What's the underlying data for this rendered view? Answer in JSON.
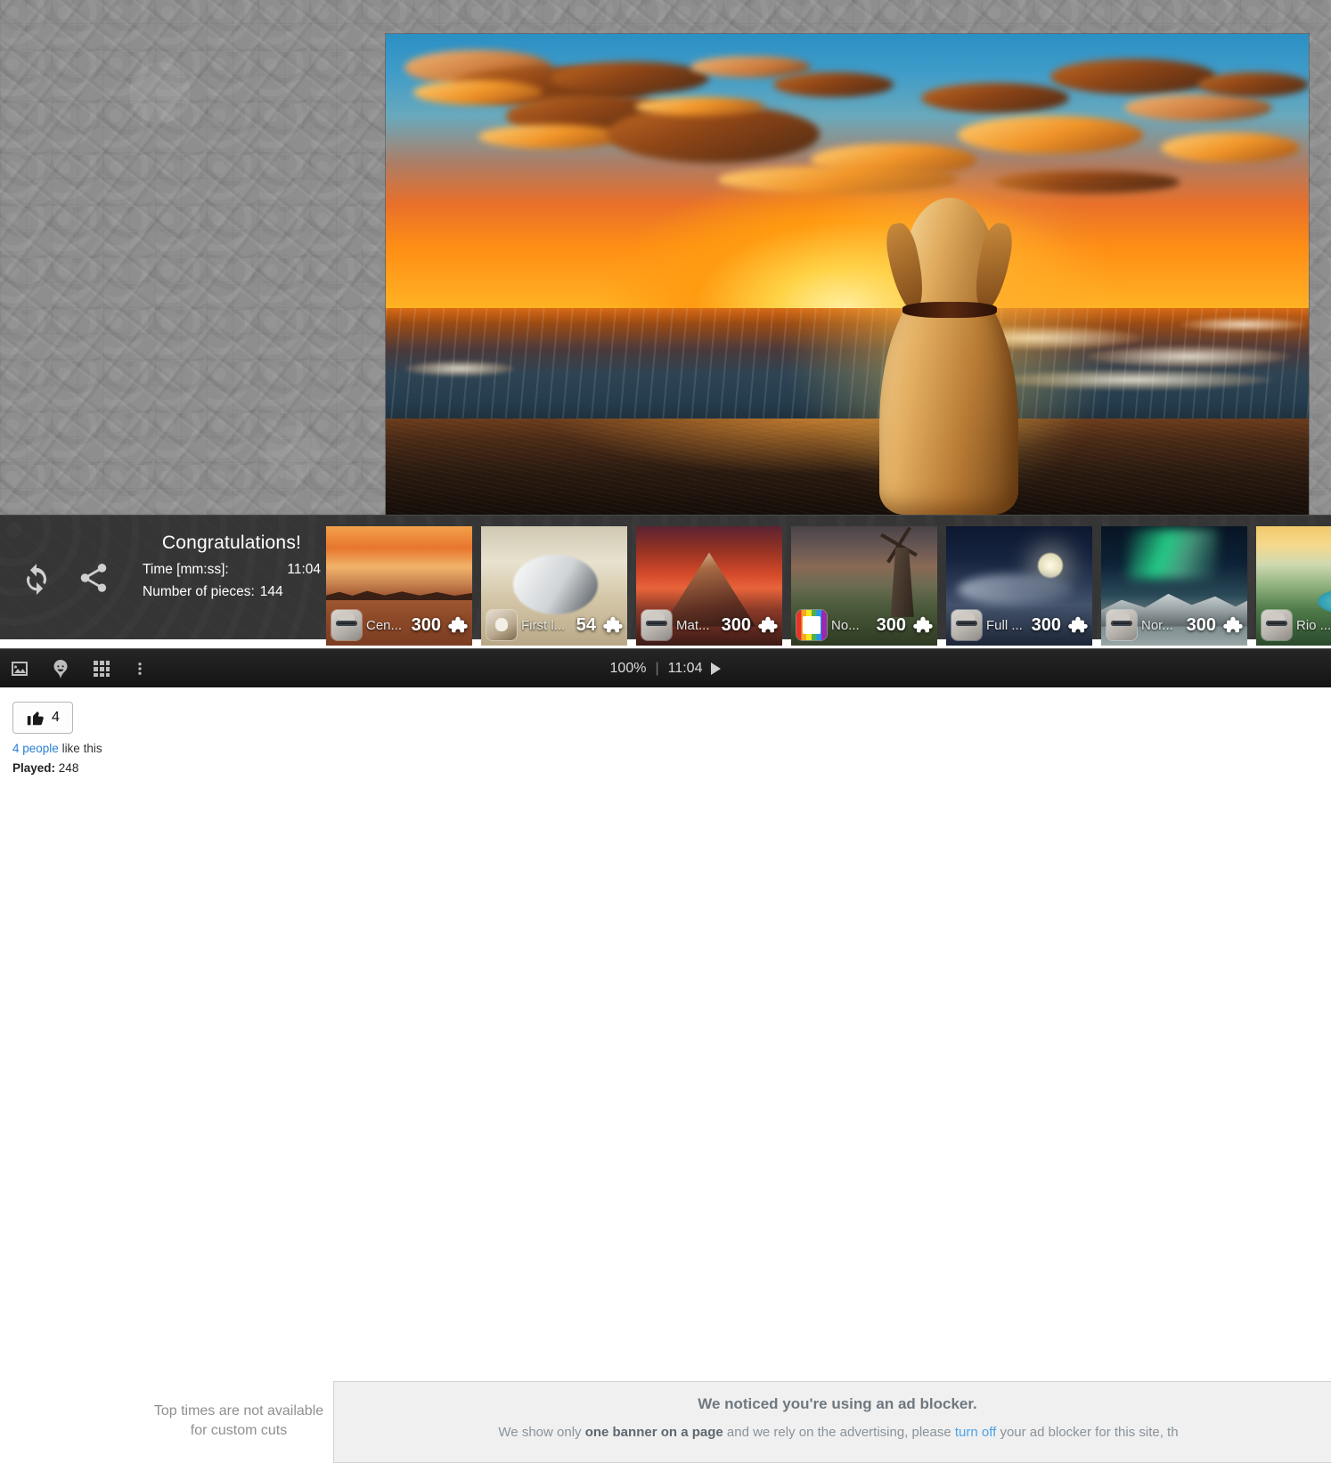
{
  "board": {
    "background_color": "#8e8e8e"
  },
  "puzzle_image": {
    "alt": "golden retriever dog sitting on beach watching ocean sunset"
  },
  "congrats": {
    "title": "Congratulations!",
    "time_label": "Time [mm:ss]:",
    "time_value": "11:04",
    "pieces_label": "Number of pieces:",
    "pieces_value": "144",
    "restart_icon": "refresh-icon",
    "share_icon": "share-icon"
  },
  "thumbnails": [
    {
      "name": "Cen...",
      "pieces": "300",
      "avatar": "face-glasses-avatar",
      "scene": "desert"
    },
    {
      "name": "First l...",
      "pieces": "54",
      "avatar": "goat-avatar",
      "scene": "dog"
    },
    {
      "name": "Mat...",
      "pieces": "300",
      "avatar": "face-glasses-avatar",
      "scene": "volcano"
    },
    {
      "name": "No...",
      "pieces": "300",
      "avatar": "rainbow-avatar",
      "scene": "mill"
    },
    {
      "name": "Full ...",
      "pieces": "300",
      "avatar": "face-glasses-avatar",
      "scene": "night"
    },
    {
      "name": "Nor...",
      "pieces": "300",
      "avatar": "face-glasses-avatar",
      "scene": "aurora"
    },
    {
      "name": "Rio ...",
      "pieces": "",
      "avatar": "face-glasses-avatar",
      "scene": "rio"
    }
  ],
  "toolbar": {
    "image_icon": "image-icon",
    "piece_icon": "puzzle-shape-icon",
    "grid_icon": "grid-icon",
    "more_icon": "more-vertical-icon",
    "zoom_level": "100%",
    "separator": "|",
    "timer": "11:04",
    "play_icon": "play-icon"
  },
  "footer": {
    "like_count": "4",
    "like_icon": "thumbs-up-icon",
    "like_sub_link": "4 people",
    "like_sub_rest": " like this",
    "played_label": "Played:",
    "played_value": "248",
    "top_times_line1": "Top times are not available",
    "top_times_line2": "for custom cuts"
  },
  "ad_notice": {
    "title": "We noticed you're using an ad blocker.",
    "body_part1": "We show only ",
    "body_bold": "one banner on a page",
    "body_part2": " and we rely on the advertising, please ",
    "body_link": "turn off",
    "body_part3": " your ad blocker for this site, th"
  }
}
